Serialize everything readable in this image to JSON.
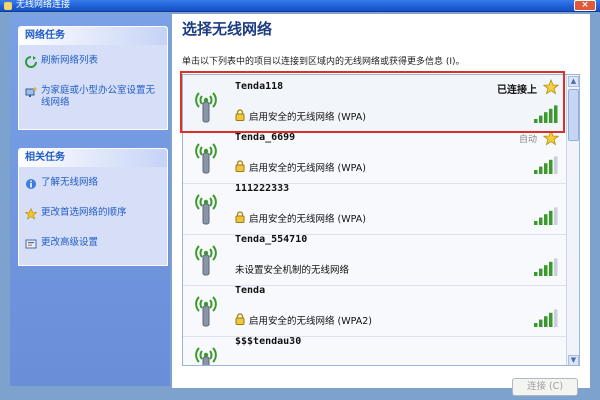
{
  "window": {
    "title": "无线网络连接"
  },
  "sidebar": {
    "network_tasks": {
      "header": "网络任务",
      "items": [
        {
          "label": "刷新网络列表",
          "icon": "refresh-icon"
        },
        {
          "label": "为家庭或小型办公室设置无线网络",
          "icon": "home-network-icon"
        }
      ]
    },
    "related_tasks": {
      "header": "相关任务",
      "items": [
        {
          "label": "了解无线网络",
          "icon": "info-icon"
        },
        {
          "label": "更改首选网络的顺序",
          "icon": "star-icon"
        },
        {
          "label": "更改高级设置",
          "icon": "settings-icon"
        }
      ]
    }
  },
  "main": {
    "heading": "选择无线网络",
    "instruction": "单击以下列表中的项目以连接到区域内的无线网络或获得更多信息 (I)。",
    "networks": [
      {
        "name": "Tenda118",
        "security": "启用安全的无线网络 (WPA)",
        "status": "已连接上",
        "preferred": true,
        "signal_bars": 5,
        "secured": true
      },
      {
        "name": "Tenda_6699",
        "security": "启用安全的无线网络 (WPA)",
        "status": "自动",
        "preferred": true,
        "signal_bars": 4,
        "secured": true
      },
      {
        "name": "111222333",
        "security": "启用安全的无线网络 (WPA)",
        "status": "",
        "preferred": false,
        "signal_bars": 4,
        "secured": true
      },
      {
        "name": "Tenda_554710",
        "security": "未设置安全机制的无线网络",
        "status": "",
        "preferred": false,
        "signal_bars": 4,
        "secured": false
      },
      {
        "name": "Tenda",
        "security": "启用安全的无线网络 (WPA2)",
        "status": "",
        "preferred": false,
        "signal_bars": 4,
        "secured": true
      },
      {
        "name": "$$$tendau30",
        "security": "",
        "status": "",
        "preferred": false,
        "signal_bars": 0,
        "secured": false
      }
    ],
    "connect_button": "连接 (C)"
  },
  "colors": {
    "accent_blue": "#215dc6",
    "highlight_red": "#d9302a",
    "signal_green": "#3c9a2c"
  }
}
